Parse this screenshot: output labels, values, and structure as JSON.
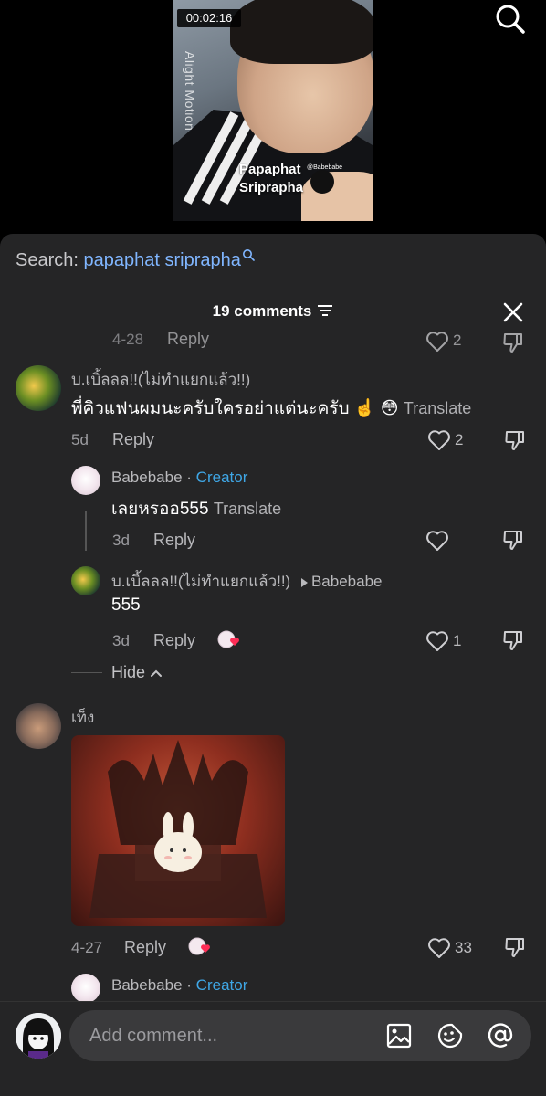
{
  "video": {
    "timestamp": "00:02:16",
    "watermark": "Alight Motion",
    "caption_line1": "Papaphat",
    "caption_line2": "Sriprapha",
    "caption_handle": "@Babebabe"
  },
  "search": {
    "prefix": "Search:",
    "query": "papaphat sriprapha"
  },
  "header": {
    "comments_count": "19 comments"
  },
  "partial_row": {
    "date": "4-28",
    "reply_label": "Reply",
    "likes": "2"
  },
  "comments": [
    {
      "username": "บ.เบิ้ลลล!!(ไม่ทำแยกแล้ว!!)",
      "text": "พี่คิวแฟนผมนะครับใครอย่าแต่นะครับ ☝️ 😳",
      "translate": "Translate",
      "date": "5d",
      "reply_label": "Reply",
      "likes": "2"
    }
  ],
  "replies": [
    {
      "username": "Babebabe",
      "separator": "·",
      "badge": "Creator",
      "text": "เลยหรออ555",
      "translate": "Translate",
      "date": "3d",
      "reply_label": "Reply"
    },
    {
      "username": "บ.เบิ้ลลล!!(ไม่ทำแยกแล้ว!!)",
      "reply_to": "Babebabe",
      "text": "555",
      "date": "3d",
      "reply_label": "Reply",
      "likes": "1"
    }
  ],
  "hide_label": "Hide",
  "second_comment": {
    "username": "เท็ง",
    "date": "4-27",
    "reply_label": "Reply",
    "likes": "33"
  },
  "next_reply": {
    "username": "Babebabe",
    "separator": "·",
    "badge": "Creator"
  },
  "input": {
    "placeholder": "Add comment..."
  },
  "colors": {
    "sheet_bg": "#252526",
    "creator": "#3fa7e6",
    "search_query": "#80b6ff"
  }
}
